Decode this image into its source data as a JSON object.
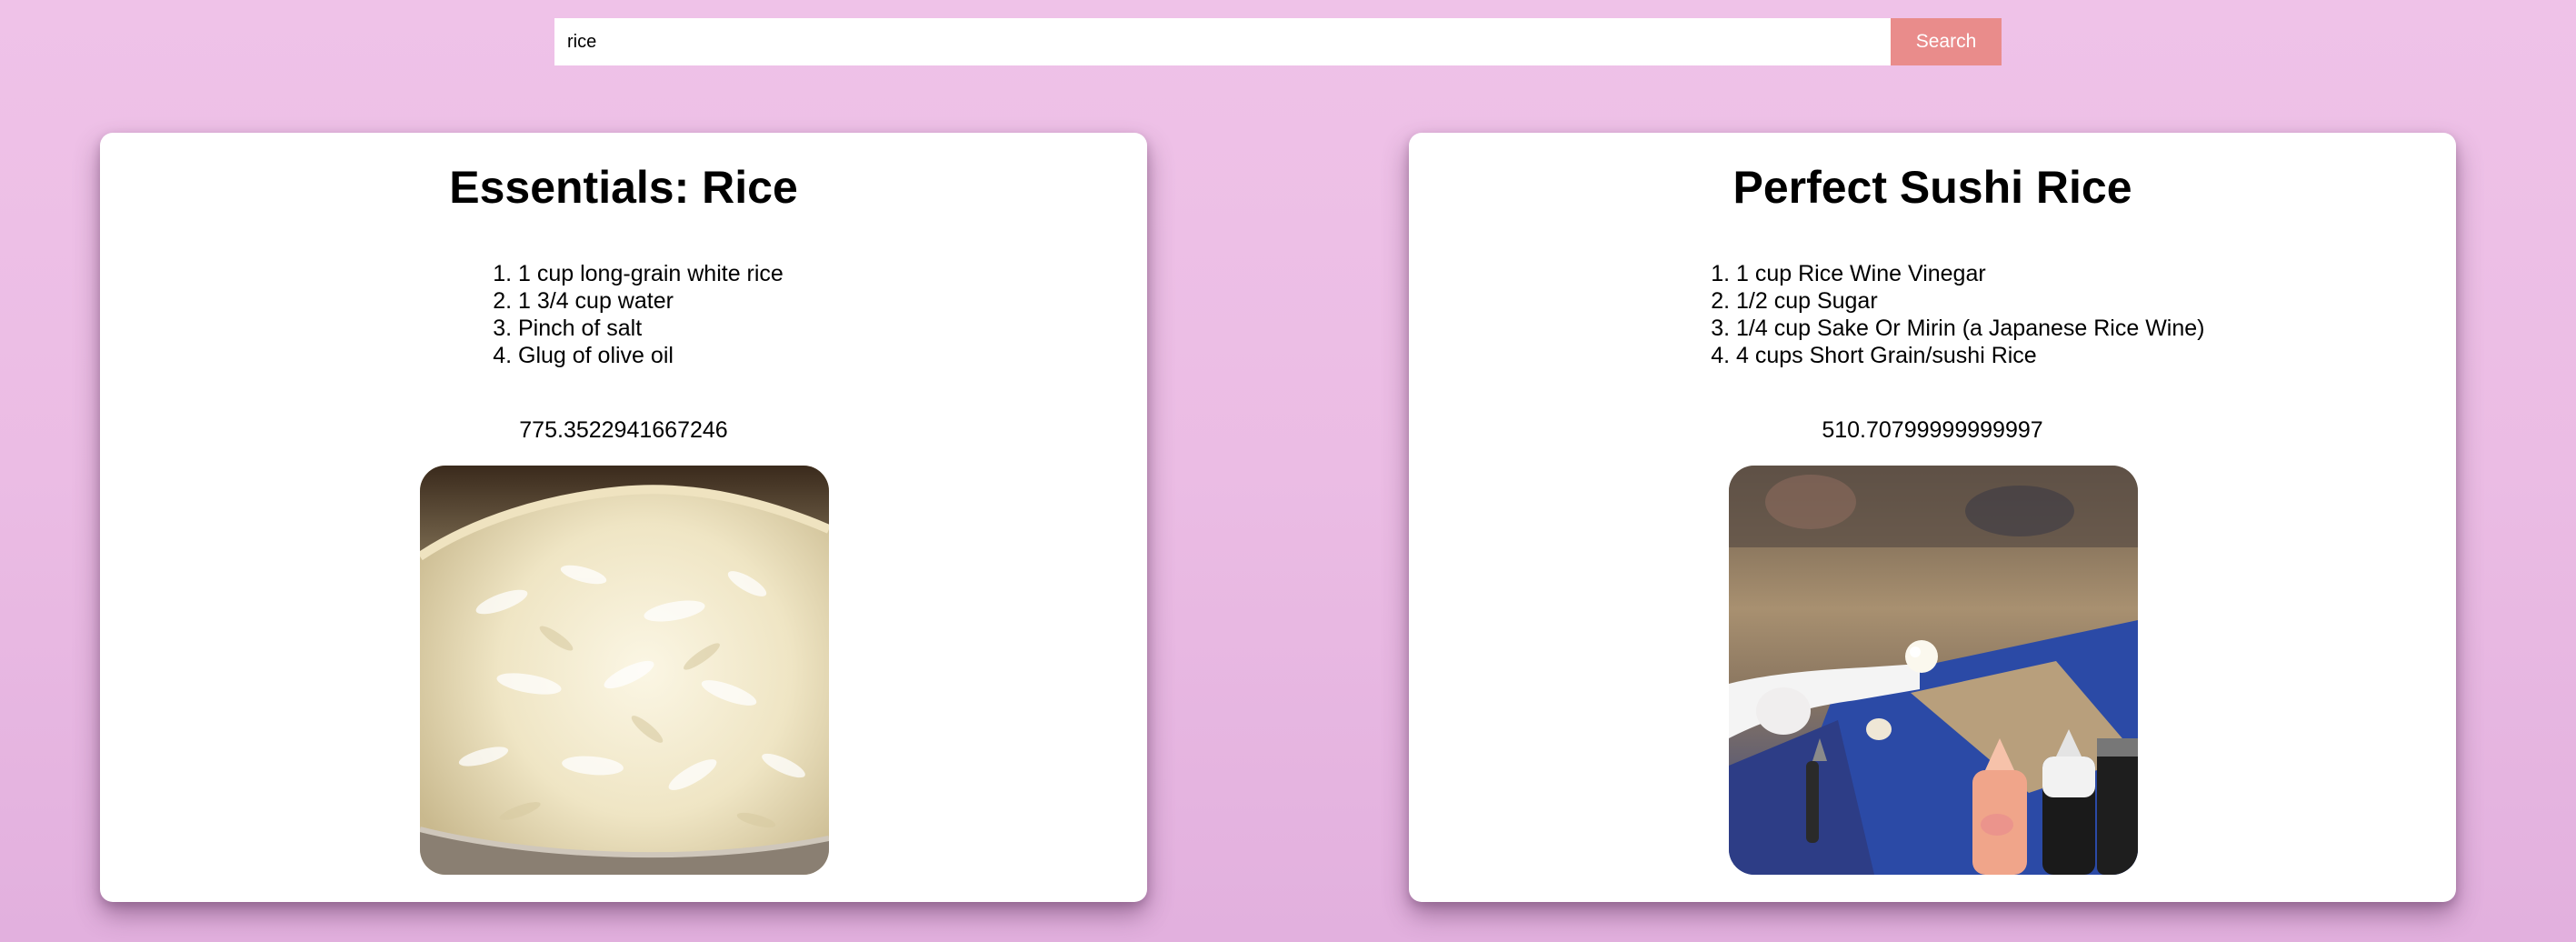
{
  "search": {
    "value": "rice",
    "button_label": "Search"
  },
  "recipes": [
    {
      "title": "Essentials: Rice",
      "ingredients": [
        "1 cup long-grain white rice",
        "1 3/4 cup water",
        "Pinch of salt",
        "Glug of olive oil"
      ],
      "score": "775.3522941667246",
      "image": "cooked-white-rice-photo"
    },
    {
      "title": "Perfect Sushi Rice",
      "ingredients": [
        "1 cup Rice Wine Vinegar",
        "1/2 cup Sugar",
        "1/4 cup Sake Or Mirin (a Japanese Rice Wine)",
        "4 cups Short Grain/sushi Rice"
      ],
      "score": "510.70799999999997",
      "image": "sushi-chef-hand-photo"
    }
  ],
  "colors": {
    "background": "#efc2e8",
    "search_button": "#e98c8b",
    "card": "#ffffff"
  }
}
